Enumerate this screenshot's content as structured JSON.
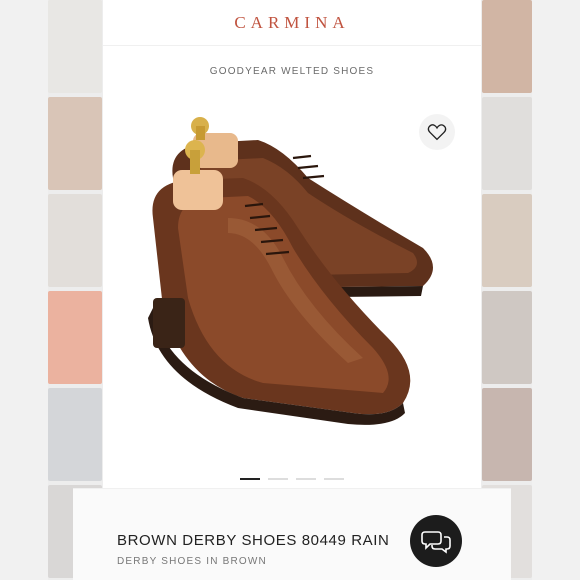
{
  "header": {
    "brand": "CARMINA"
  },
  "category": {
    "label": "GOODYEAR WELTED SHOES"
  },
  "product": {
    "name": "BROWN DERBY SHOES 80449 RAIN",
    "description": "DERBY SHOES IN BROWN",
    "image_icon": "brown-derby-shoe-pair"
  },
  "carousel": {
    "total_slides": 4,
    "active_slide": 1
  },
  "icons": {
    "wishlist": "heart-icon",
    "chat": "chat-bubbles-icon"
  },
  "colors": {
    "brand": "#c0533f",
    "chat_button": "#1c1c1c",
    "active_dot": "#222222"
  }
}
